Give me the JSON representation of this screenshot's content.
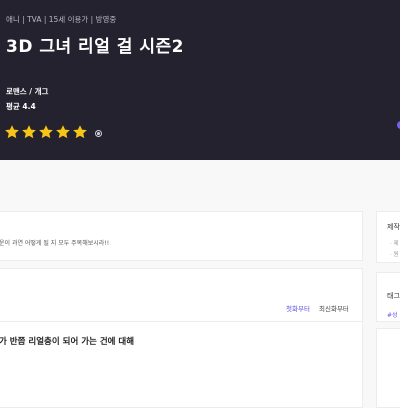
{
  "hero": {
    "meta": "애니 | TVA | 15세 이용가 | 방영중",
    "title": "3D 그녀 리얼 걸 시즌2",
    "genre": "로맨스 / 개그",
    "rating": "평균 4.4",
    "stars": 5,
    "star_color": "#f5c518"
  },
  "synopsis": {
    "text": "운이 과연 어떻게 될 지 모두 주목해보시라!!"
  },
  "episodes": {
    "sort_first": "첫화부터",
    "sort_latest": "최신화부터",
    "first_episode_title": "가 반쯤 리얼충이 되어 가는 건에 대해"
  },
  "side": {
    "info_heading": "제작",
    "info_lines": [
      "· 제",
      "· 원"
    ],
    "tags_heading": "태그",
    "tag": "#성"
  },
  "colors": {
    "hero_bg": "#252230",
    "accent": "#5b4fe0"
  }
}
